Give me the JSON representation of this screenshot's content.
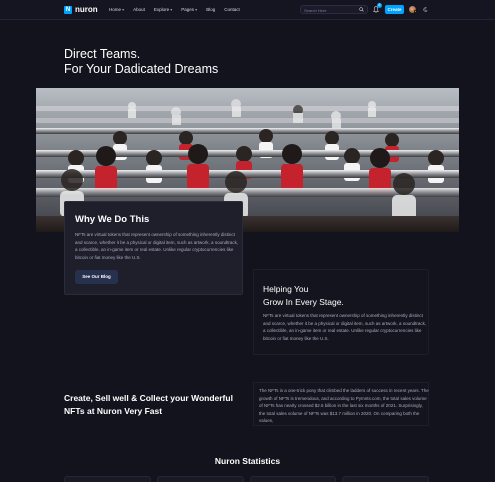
{
  "nav": {
    "logo_mark": "N",
    "logo_text": "nuron",
    "menu": [
      {
        "label": "Home",
        "caret": true
      },
      {
        "label": "About",
        "caret": false
      },
      {
        "label": "Explore",
        "caret": true
      },
      {
        "label": "Pages",
        "caret": true
      },
      {
        "label": "Blog",
        "caret": false
      },
      {
        "label": "Contact",
        "caret": false
      }
    ],
    "search_placeholder": "Search Here",
    "search_icon": "search-icon",
    "notification_icon": "bell-icon",
    "notification_count": "6",
    "create_label": "Create",
    "theme_icon": "moon-icon",
    "accent_color": "#00a3ff"
  },
  "hero": {
    "title_line1": "Direct Teams.",
    "title_line2": "For Your Dadicated Dreams"
  },
  "why": {
    "title": "Why We Do This",
    "body": "NFTs are virtual tokens that represent ownership of something inherently distinct and scarce, whether it be a physical or digital item, such as artwork, a soundtrack, a collectible, an in-game item or real estate. Unlike regular cryptocurrencies like bitcoin or fiat money like the U.S.",
    "button_label": "See Our Blog"
  },
  "help": {
    "title_line1": "Helping You",
    "title_line2": "Grow In Every Stage.",
    "body": "NFTs are virtual tokens that represent ownership of something inherently distinct and scarce, whether it be a physical or digital item, such as artwork, a soundtrack, a collectible, an in-game item or real estate. Unlike regular cryptocurrencies like bitcoin or fiat money like the U.S."
  },
  "create": {
    "title": "Create, Sell well & Collect your Wonderful NFTs at Nuron Very Fast",
    "body": "The NFTs is a one-trick pony that climbed the ladders of success in recent years. The growth of NFTs is tremendous, and according to Pymnts.com, the total sales volume of NFTs has nearly crossed $2.5 billion in the last six months of 2021. Surprisingly, the total sales volume of NFTs was $13.7 million in 2020. On comparing both the values,"
  },
  "stats": {
    "title": "Nuron Statistics"
  }
}
